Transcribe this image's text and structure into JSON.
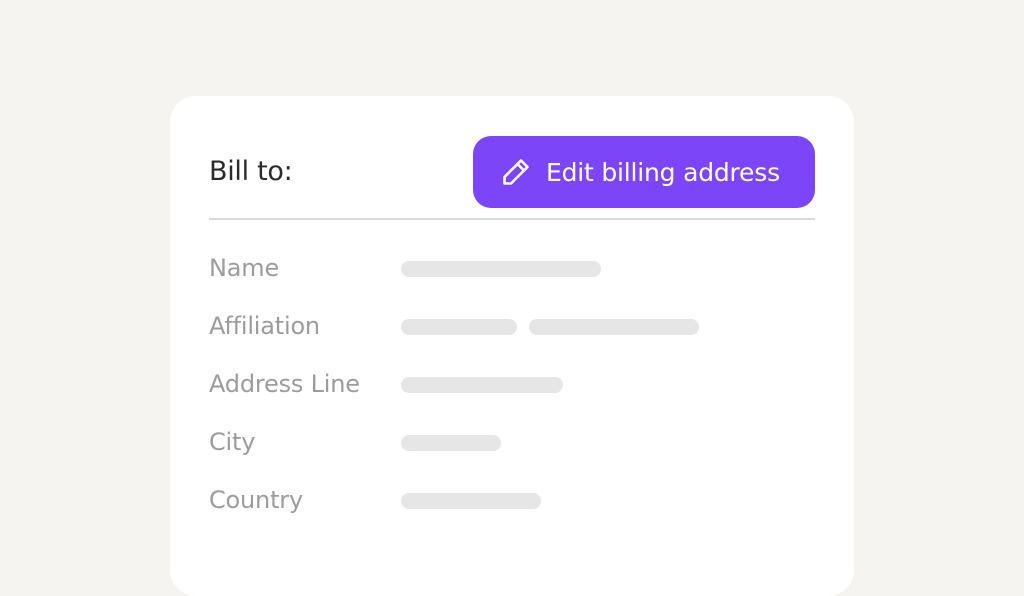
{
  "header": {
    "title": "Bill to:",
    "edit_button_label": "Edit billing address",
    "edit_button_icon": "pencil-icon"
  },
  "fields": [
    {
      "label": "Name"
    },
    {
      "label": "Affiliation"
    },
    {
      "label": "Address Line"
    },
    {
      "label": "City"
    },
    {
      "label": "Country"
    }
  ],
  "colors": {
    "accent": "#7c45f7",
    "background": "#f5f4f1",
    "card": "#ffffff",
    "label_text": "#9c9c9c",
    "placeholder_bar": "#e6e6e6"
  }
}
